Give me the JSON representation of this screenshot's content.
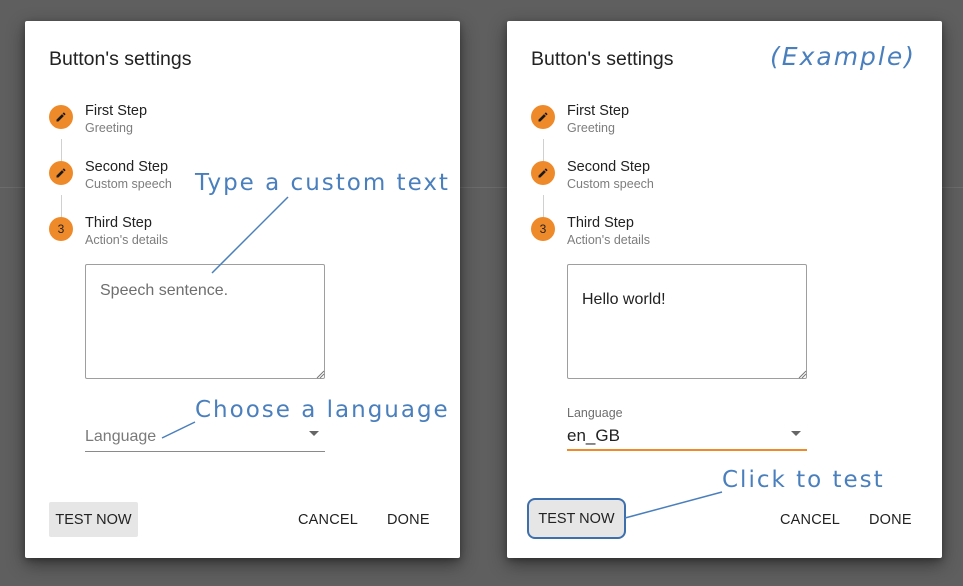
{
  "left_dialog": {
    "title": "Button's settings",
    "steps": [
      {
        "icon": "pencil-icon",
        "title": "First Step",
        "subtitle": "Greeting"
      },
      {
        "icon": "pencil-icon",
        "title": "Second Step",
        "subtitle": "Custom speech"
      },
      {
        "number": "3",
        "title": "Third Step",
        "subtitle": "Action's details"
      }
    ],
    "speech_placeholder": "Speech sentence.",
    "speech_value": "",
    "language_placeholder": "Language",
    "buttons": {
      "test": "TEST NOW",
      "cancel": "CANCEL",
      "done": "DONE"
    }
  },
  "right_dialog": {
    "title": "Button's settings",
    "example_tag": "(Example)",
    "steps": [
      {
        "icon": "pencil-icon",
        "title": "First Step",
        "subtitle": "Greeting"
      },
      {
        "icon": "pencil-icon",
        "title": "Second Step",
        "subtitle": "Custom speech"
      },
      {
        "number": "3",
        "title": "Third Step",
        "subtitle": "Action's details"
      }
    ],
    "speech_value": "Hello world!",
    "language_label": "Language",
    "language_value": "en_GB",
    "buttons": {
      "test": "TEST NOW",
      "cancel": "CANCEL",
      "done": "DONE"
    }
  },
  "annotations": {
    "custom_text": "Type a custom text",
    "choose_language": "Choose a language",
    "click_to_test": "Click to test"
  },
  "colors": {
    "accent": "#ef8a2a",
    "annotation": "#4a7fbd",
    "backdrop": "#5f5f5f"
  }
}
